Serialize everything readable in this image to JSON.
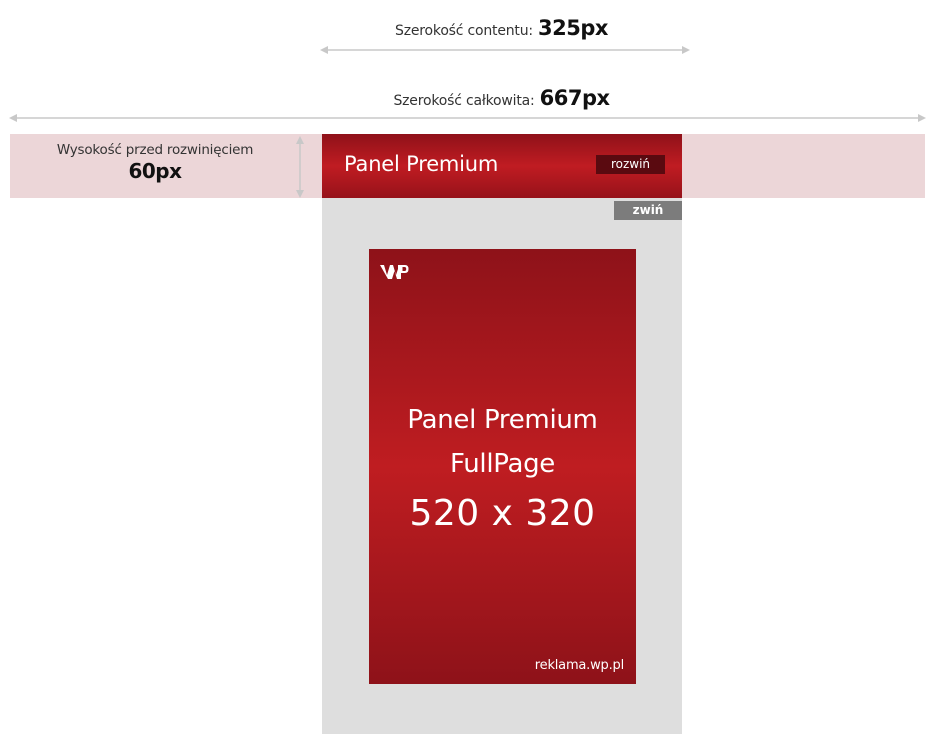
{
  "content_width": {
    "label": "Szerokość contentu:",
    "value": "325px"
  },
  "total_width": {
    "label": "Szerokość całkowita:",
    "value": "667px"
  },
  "height_before_expand": {
    "label": "Wysokość przed rozwinięciem",
    "value": "60px"
  },
  "panel": {
    "title": "Panel Premium",
    "expand_label": "rozwiń",
    "collapse_label": "zwiń"
  },
  "ad": {
    "title_line1": "Panel Premium",
    "title_line2": "FullPage",
    "size": "520 x 320",
    "footer": "reklama.wp.pl",
    "logo_icon": "wp-logo"
  },
  "colors": {
    "brand_red": "#c01c22",
    "brand_dark_red": "#8e1219",
    "band_pink": "#ecd6d8",
    "panel_gray": "#dedede",
    "arrow_gray": "#c8c8c8"
  }
}
